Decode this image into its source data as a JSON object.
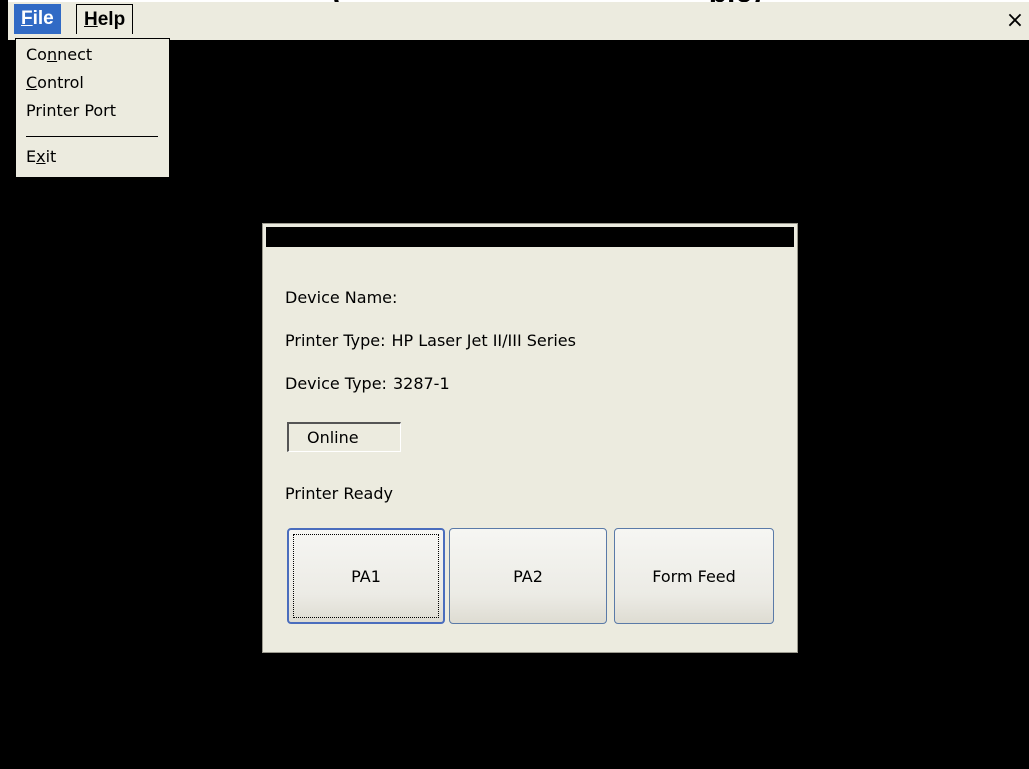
{
  "header": {
    "partial_title": "(                                            pic)"
  },
  "menubar": {
    "file": {
      "accel": "F",
      "rest": "ile"
    },
    "help": {
      "accel": "H",
      "rest": "elp"
    },
    "close_glyph": "×"
  },
  "file_menu": {
    "items": [
      {
        "pre": "Co",
        "accel": "n",
        "post": "nect"
      },
      {
        "pre": "",
        "accel": "C",
        "post": "ontrol"
      },
      {
        "pre": "Printer Port",
        "accel": "",
        "post": ""
      },
      {
        "pre": "E",
        "accel": "x",
        "post": "it"
      }
    ]
  },
  "dialog": {
    "device_name_label": "Device Name:",
    "device_name_value": "",
    "printer_type_label": "Printer Type:",
    "printer_type_value": "HP Laser Jet II/III Series",
    "device_type_label": "Device Type:",
    "device_type_value": "3287-1",
    "status": "Online",
    "ready_text": "Printer Ready",
    "buttons": {
      "pa1": "PA1",
      "pa2": "PA2",
      "form_feed": "Form Feed"
    }
  },
  "colors": {
    "menu_highlight": "#316ac5",
    "dialog_bg": "#ecebdf",
    "desktop": "#000000"
  }
}
